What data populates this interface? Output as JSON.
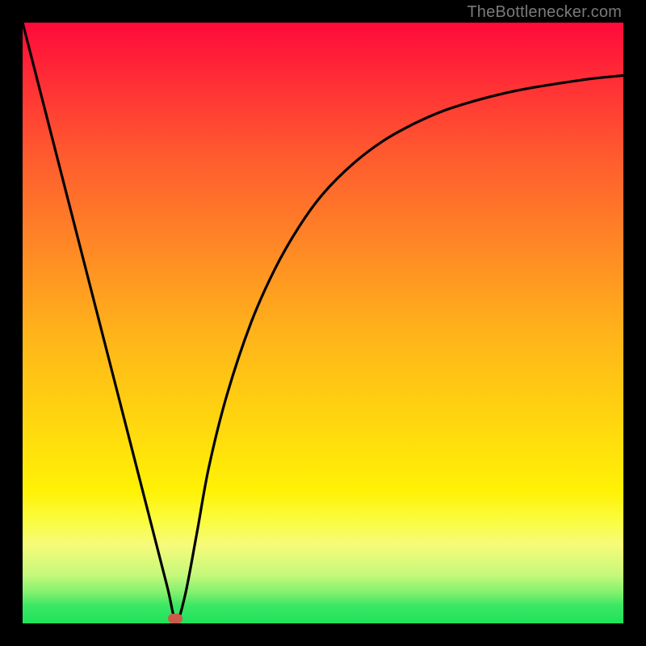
{
  "credit_text": "TheBottlenecker.com",
  "chart_data": {
    "type": "line",
    "title": "",
    "xlabel": "",
    "ylabel": "",
    "xlim": [
      0,
      100
    ],
    "ylim": [
      0,
      100
    ],
    "series": [
      {
        "name": "curve",
        "x": [
          0,
          5,
          10,
          15,
          20,
          24,
          25.5,
          27,
          29,
          31,
          34,
          38,
          42,
          46,
          50,
          55,
          60,
          65,
          70,
          75,
          80,
          85,
          90,
          95,
          100
        ],
        "values": [
          100,
          80.5,
          61,
          41.5,
          22,
          6.4,
          0.5,
          4.5,
          15,
          26,
          38,
          50,
          59,
          66,
          71.5,
          76.5,
          80.3,
          83.1,
          85.3,
          86.9,
          88.2,
          89.2,
          90,
          90.7,
          91.2
        ]
      }
    ],
    "marker": {
      "x_pct": 25.4,
      "y_pct": 0.8
    },
    "gradient_stops": [
      {
        "pos": 0,
        "color": "#ff0a3a"
      },
      {
        "pos": 10,
        "color": "#ff2f36"
      },
      {
        "pos": 22,
        "color": "#ff5a2f"
      },
      {
        "pos": 38,
        "color": "#ff8a25"
      },
      {
        "pos": 52,
        "color": "#ffb41a"
      },
      {
        "pos": 66,
        "color": "#ffd50f"
      },
      {
        "pos": 78,
        "color": "#fff205"
      },
      {
        "pos": 83,
        "color": "#fafc40"
      },
      {
        "pos": 87,
        "color": "#f6fb7a"
      },
      {
        "pos": 92,
        "color": "#c4f87b"
      },
      {
        "pos": 95,
        "color": "#7ef06e"
      },
      {
        "pos": 97,
        "color": "#3ce763"
      },
      {
        "pos": 100,
        "color": "#1ee25c"
      }
    ]
  }
}
